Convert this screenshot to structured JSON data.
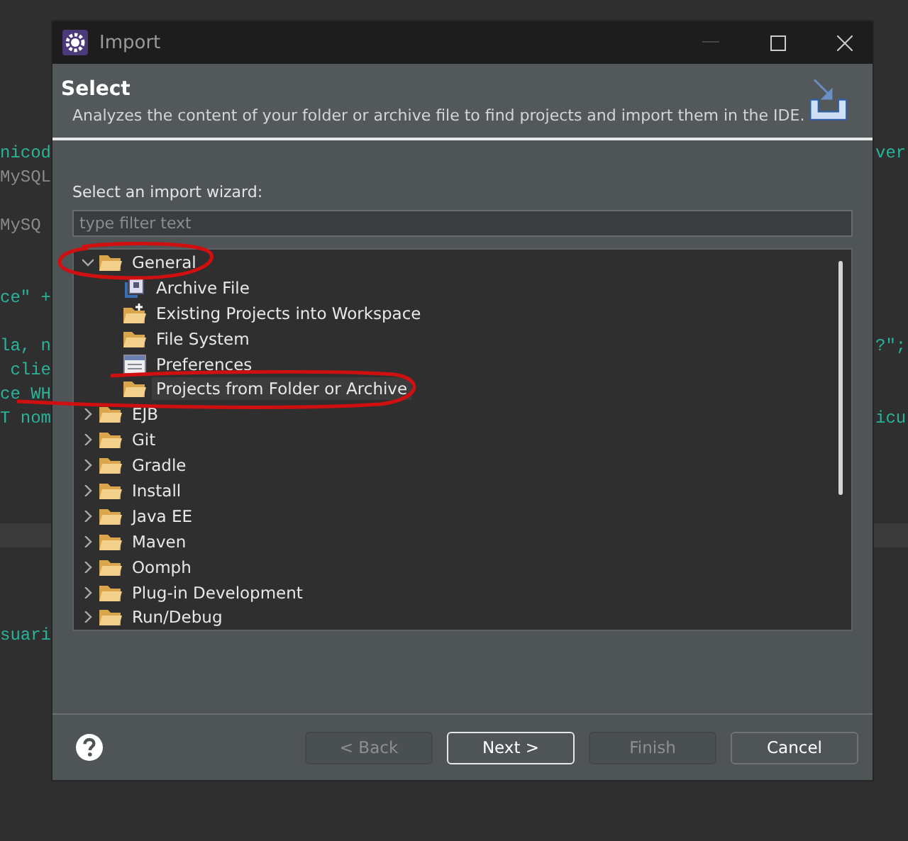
{
  "editor": {
    "lines": [
      {
        "kind": "code",
        "left": {
          "text": "nicod",
          "color": "#2bb39a"
        },
        "right": "ver"
      },
      {
        "kind": "code",
        "left": {
          "text": "MySQL",
          "color": "#8a8a8a"
        }
      },
      {
        "kind": "blank"
      },
      {
        "kind": "code",
        "left": {
          "text": "MySQ",
          "color": "#8a8a8a"
        }
      },
      {
        "kind": "blank"
      },
      {
        "kind": "blank"
      },
      {
        "kind": "code",
        "left": {
          "text": "ce\" +",
          "color": "#2bb39a"
        }
      },
      {
        "kind": "blank"
      },
      {
        "kind": "code",
        "left": {
          "text": "la, n",
          "color": "#2bb39a"
        },
        "right": "?\";"
      },
      {
        "kind": "code",
        "left": {
          "text": " clie",
          "color": "#2bb39a"
        }
      },
      {
        "kind": "code",
        "left": {
          "text": "ce WH",
          "color": "#2bb39a"
        }
      },
      {
        "kind": "code",
        "left": {
          "text": "T nom",
          "color": "#2bb39a"
        },
        "right": "icu"
      },
      {
        "kind": "blank"
      },
      {
        "kind": "blank"
      },
      {
        "kind": "blank"
      },
      {
        "kind": "blank"
      },
      {
        "kind": "blank"
      },
      {
        "kind": "blank"
      },
      {
        "kind": "blank"
      },
      {
        "kind": "blank"
      },
      {
        "kind": "code",
        "left": {
          "text": "suari",
          "color": "#2bb39a"
        }
      }
    ]
  },
  "window": {
    "title": "Import"
  },
  "header": {
    "title": "Select",
    "description": "Analyzes the content of your folder or archive file to find projects and import them in the IDE."
  },
  "wizard_label": "Select an import wizard:",
  "filter": {
    "placeholder": "type filter text"
  },
  "tree": [
    {
      "label": "General",
      "kind": "folder",
      "expanded": true,
      "selected": false,
      "children": [
        {
          "label": "Archive File",
          "kind": "archive",
          "selected": false
        },
        {
          "label": "Existing Projects into Workspace",
          "kind": "projects",
          "selected": false
        },
        {
          "label": "File System",
          "kind": "folder",
          "selected": false
        },
        {
          "label": "Preferences",
          "kind": "preferences",
          "selected": false
        },
        {
          "label": "Projects from Folder or Archive",
          "kind": "folder",
          "selected": true
        }
      ]
    },
    {
      "label": "EJB",
      "kind": "folder",
      "expanded": false,
      "selected": false
    },
    {
      "label": "Git",
      "kind": "folder",
      "expanded": false,
      "selected": false
    },
    {
      "label": "Gradle",
      "kind": "folder",
      "expanded": false,
      "selected": false
    },
    {
      "label": "Install",
      "kind": "folder",
      "expanded": false,
      "selected": false
    },
    {
      "label": "Java EE",
      "kind": "folder",
      "expanded": false,
      "selected": false
    },
    {
      "label": "Maven",
      "kind": "folder",
      "expanded": false,
      "selected": false
    },
    {
      "label": "Oomph",
      "kind": "folder",
      "expanded": false,
      "selected": false
    },
    {
      "label": "Plug-in Development",
      "kind": "folder",
      "expanded": false,
      "selected": false
    },
    {
      "label": "Run/Debug",
      "kind": "folder",
      "expanded": false,
      "selected": false
    }
  ],
  "buttons": [
    {
      "label": "< Back",
      "disabled": true,
      "default": false
    },
    {
      "label": "Next >",
      "disabled": false,
      "default": true
    },
    {
      "label": "Finish",
      "disabled": true,
      "default": false
    },
    {
      "label": "Cancel",
      "disabled": false,
      "default": false
    }
  ]
}
